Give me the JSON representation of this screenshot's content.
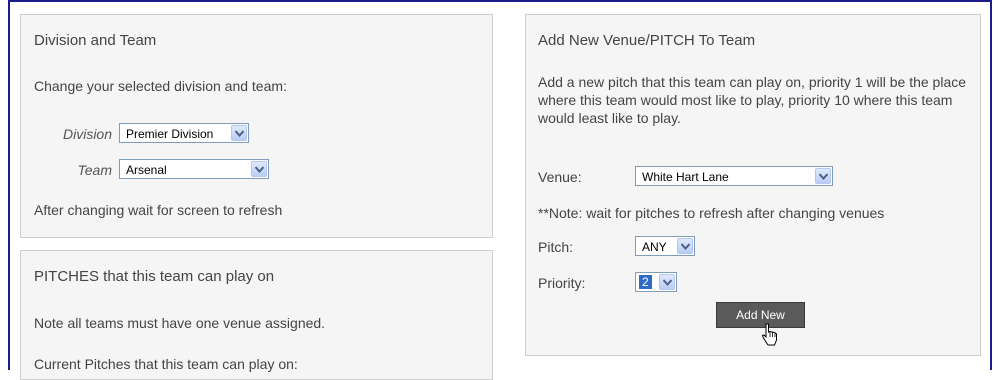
{
  "left_panel": {
    "title": "Division and Team",
    "subtitle": "Change your selected division and team:",
    "division_label": "Division",
    "division_value": "Premier Division",
    "team_label": "Team",
    "team_value": "Arsenal",
    "note": "After changing wait for screen to refresh"
  },
  "pitches_panel": {
    "title": "PITCHES that this team can play on",
    "note": "Note all teams must have one venue assigned.",
    "current": "Current Pitches that this team can play on:"
  },
  "right_panel": {
    "title": "Add New Venue/PITCH To Team",
    "description": "Add a new pitch that this team can play on, priority 1 will be the place where this team would most like to play, priority 10 where this team would least like to play.",
    "venue_label": "Venue:",
    "venue_value": "White Hart Lane",
    "venue_note": "**Note: wait for pitches to refresh after changing venues",
    "pitch_label": "Pitch:",
    "pitch_value": "ANY",
    "priority_label": "Priority:",
    "priority_value": "2",
    "add_button": "Add New"
  },
  "colors": {
    "frame": "#1c1c8c",
    "panel_bg": "#f5f5f5",
    "button_bg": "#5a5a5a",
    "selection": "#316ac5"
  },
  "icons": [
    "chevron-down-icon",
    "mouse-cursor-icon"
  ]
}
